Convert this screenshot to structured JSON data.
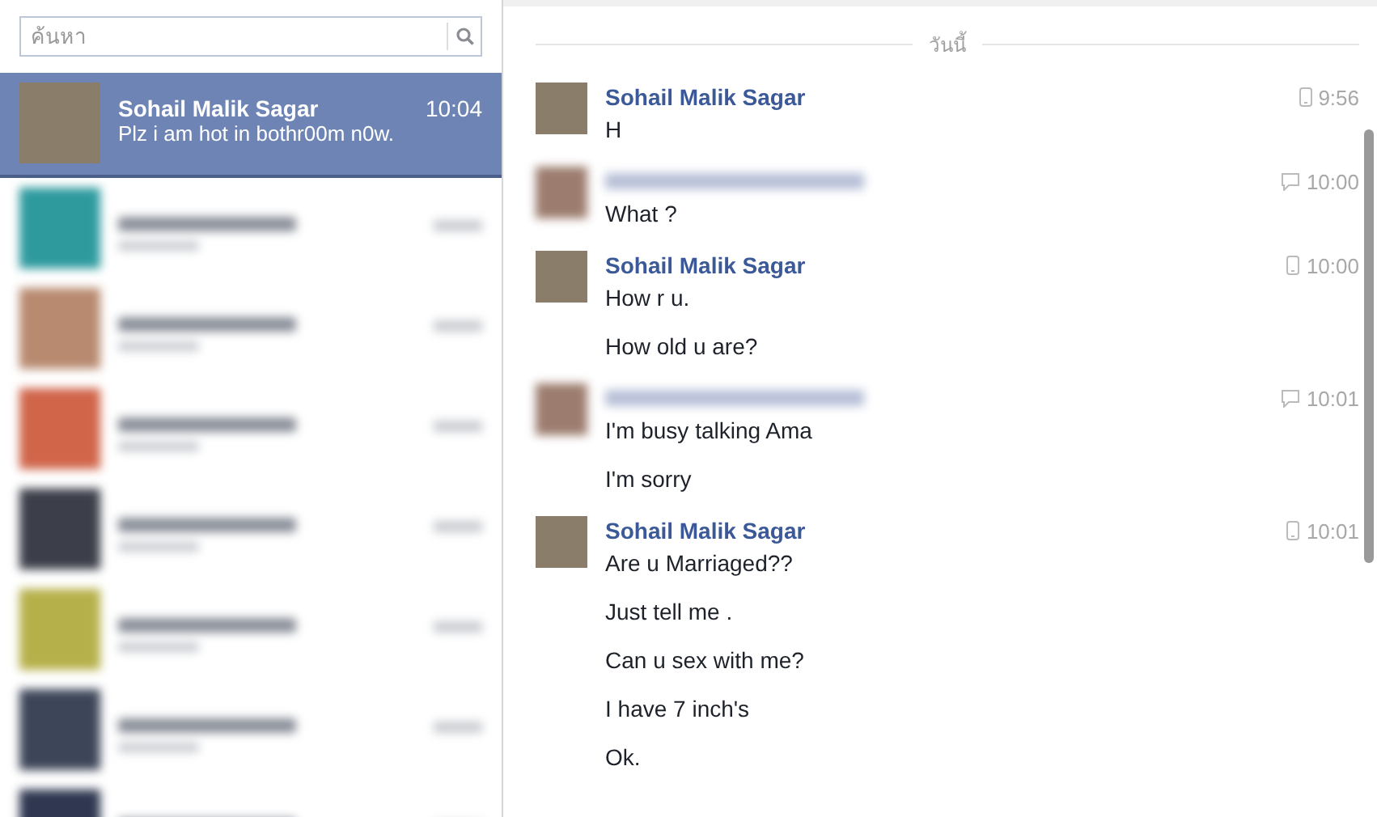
{
  "search": {
    "placeholder": "ค้นหา"
  },
  "conversations": [
    {
      "kind": "visible",
      "name": "Sohail Malik Sagar",
      "preview": "Plz i am hot in bothr00m n0w.",
      "time": "10:04",
      "selected": true
    },
    {
      "kind": "redacted",
      "color": "#2e9a9e",
      "selected": false
    },
    {
      "kind": "redacted",
      "color": "#b88a70",
      "selected": false
    },
    {
      "kind": "redacted",
      "color": "#d0654a",
      "selected": false
    },
    {
      "kind": "redacted",
      "color": "#3c3f4a",
      "selected": false
    },
    {
      "kind": "redacted",
      "color": "#b6b04a",
      "selected": false
    },
    {
      "kind": "redacted",
      "color": "#3d4659",
      "selected": false
    },
    {
      "kind": "redacted",
      "color": "#2f3850",
      "selected": false
    }
  ],
  "chat": {
    "date_divider": "วันนี้",
    "groups": [
      {
        "kind": "named",
        "sender": "Sohail Malik Sagar",
        "timestamp": {
          "kind": "mobile",
          "text": "9:56"
        },
        "messages": [
          "H"
        ]
      },
      {
        "kind": "redacted",
        "timestamp": {
          "kind": "chat",
          "text": "10:00"
        },
        "messages": [
          "What ?"
        ]
      },
      {
        "kind": "named",
        "sender": "Sohail Malik Sagar",
        "timestamp": {
          "kind": "mobile",
          "text": "10:00"
        },
        "messages": [
          "How r u.",
          "How old u are?"
        ]
      },
      {
        "kind": "redacted",
        "timestamp": {
          "kind": "chat",
          "text": "10:01"
        },
        "messages": [
          "I'm busy talking Ama",
          "I'm sorry"
        ]
      },
      {
        "kind": "named",
        "sender": "Sohail Malik Sagar",
        "timestamp": {
          "kind": "mobile",
          "text": "10:01"
        },
        "messages": [
          "Are u Marriaged??",
          "Just tell me .",
          "Can u sex with me?",
          "I have 7 inch's",
          "Ok."
        ]
      }
    ]
  }
}
